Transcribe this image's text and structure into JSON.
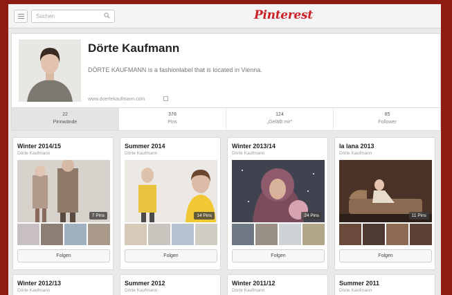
{
  "header": {
    "search_placeholder": "Suchen",
    "logo_text": "Pinterest"
  },
  "profile": {
    "name": "Dörte Kaufmann",
    "bio": "DÖRTE KAUFMANN is a fashionlabel that is located in Vienna.",
    "website": "www.doertekaufmann.com"
  },
  "stats": [
    {
      "value": "22",
      "label": "Pinnwände"
    },
    {
      "value": "378",
      "label": "Pins"
    },
    {
      "value": "124",
      "label": "„Gefällt mir\""
    },
    {
      "value": "85",
      "label": "Follower"
    }
  ],
  "boards": [
    {
      "title": "Winter 2014/15",
      "owner": "Dörte Kaufmann",
      "pins": "7 Pins",
      "follow": "Folgen"
    },
    {
      "title": "Summer 2014",
      "owner": "Dörte Kaufmann",
      "pins": "14 Pins",
      "follow": "Folgen"
    },
    {
      "title": "Winter 2013/14",
      "owner": "Dörte Kaufmann",
      "pins": "24 Pins",
      "follow": "Folgen"
    },
    {
      "title": "la lana 2013",
      "owner": "Dörte Kaufmann",
      "pins": "11 Pins",
      "follow": "Folgen"
    },
    {
      "title": "Winter 2012/13",
      "owner": "Dörte Kaufmann"
    },
    {
      "title": "Summer 2012",
      "owner": "Dörte Kaufmann"
    },
    {
      "title": "Winter 2011/12",
      "owner": "Dörte Kaufmann"
    },
    {
      "title": "Summer 2011",
      "owner": "Dörte Kaufmann"
    }
  ],
  "colors": {
    "brand_red": "#cb2027",
    "frame": "#8e1c12",
    "active_tab": "#e4e4e4"
  }
}
